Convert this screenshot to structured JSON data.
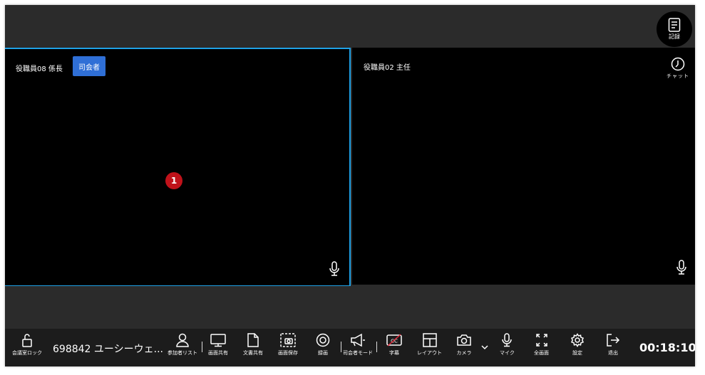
{
  "header": {
    "record_label": "記録"
  },
  "tiles": [
    {
      "name": "役職員08  係長",
      "host_badge": "司会者",
      "index_badge": "1"
    },
    {
      "name": "役職員02  主任"
    }
  ],
  "side": {
    "chat_label": "チャット"
  },
  "toolbar": {
    "lock_label": "会議室ロック",
    "meeting_id": "698842  ユーシーウェ...",
    "participants_label": "参加者リスト",
    "screen_share_label": "画面共有",
    "doc_share_label": "文書共有",
    "screen_save_label": "画面保存",
    "record_label": "録画",
    "host_mode_label": "司会者モード",
    "caption_label": "字幕",
    "layout_label": "レイアウト",
    "camera_label": "カメラ",
    "mic_label": "マイク",
    "fullscreen_label": "全画面",
    "settings_label": "設定",
    "exit_label": "退出",
    "timer": "00:18:10"
  },
  "colors": {
    "active_border": "#1ea1e6",
    "host_badge": "#2f6fd6",
    "index_badge": "#c0121a"
  }
}
